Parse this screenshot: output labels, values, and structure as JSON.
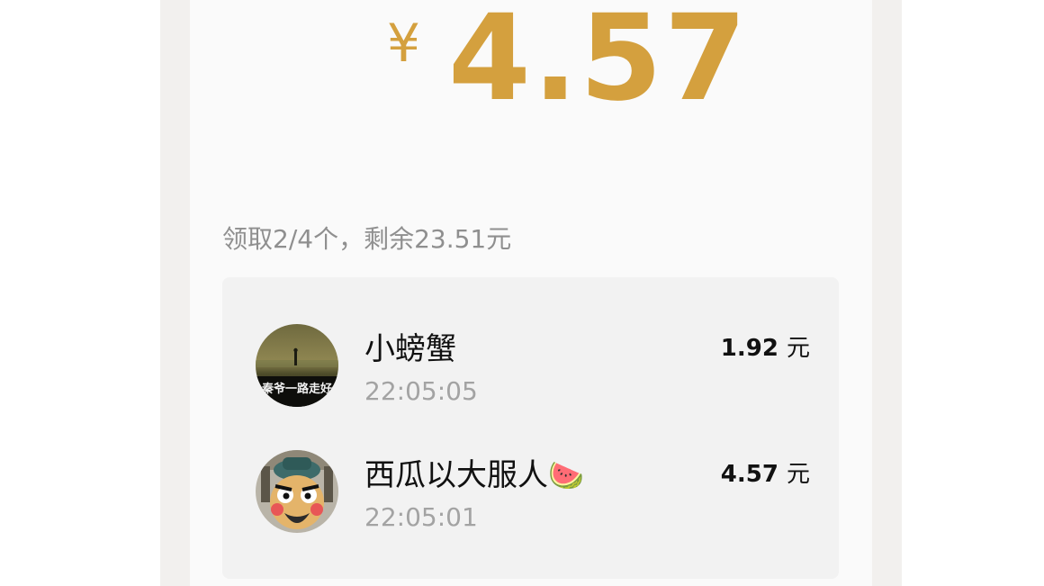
{
  "packet": {
    "currency_symbol": "¥",
    "amount": "4.57",
    "summary": "领取2/4个，剩余23.51元"
  },
  "records": [
    {
      "name": "小螃蟹",
      "time": "22:05:05",
      "amount": "1.92",
      "unit": "元",
      "avatar_caption": "秦爷一路走好",
      "avatar_icon": "landscape-avatar"
    },
    {
      "name": "西瓜以大服人",
      "emoji": "🍉",
      "time": "22:05:01",
      "amount": "4.57",
      "unit": "元",
      "avatar_icon": "cartoon-warrior-avatar"
    }
  ],
  "colors": {
    "accent_gold": "#d4a03e",
    "panel": "#fafafa",
    "list_bg": "#f2f2f2",
    "muted_text": "#a3a3a3"
  }
}
